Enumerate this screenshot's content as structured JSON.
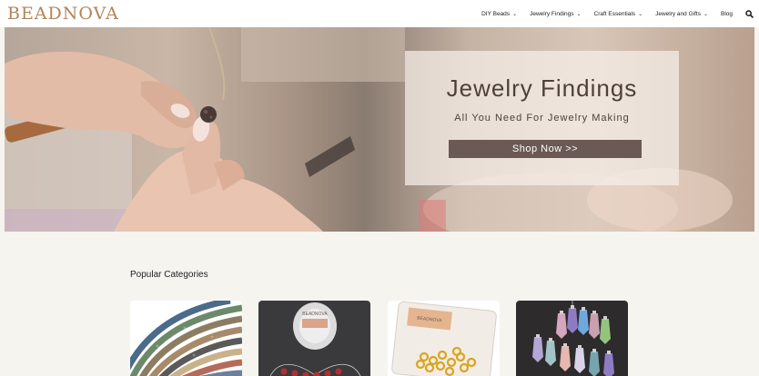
{
  "header": {
    "logo": "BEADNOVA",
    "nav": [
      {
        "label": "DIY Beads",
        "dropdown": true
      },
      {
        "label": "Jewelry Findings",
        "dropdown": true
      },
      {
        "label": "Craft Essentials",
        "dropdown": true
      },
      {
        "label": "Jewelry and Gifts",
        "dropdown": true
      },
      {
        "label": "Blog",
        "dropdown": false
      }
    ],
    "search_icon": "search-icon"
  },
  "hero": {
    "title": "Jewelry Findings",
    "subtitle": "All You Need For Jewelry Making",
    "button_label": "Shop Now >>"
  },
  "categories": {
    "title": "Popular Categories",
    "cards": [
      {
        "image": "lava-bead-strands"
      },
      {
        "image": "beadnova-elastic-cord-spool",
        "logo_text": "BEADNOVA"
      },
      {
        "image": "beadnova-gold-jump-rings-box",
        "logo_text": "BEADNOVA"
      },
      {
        "image": "crystal-point-pendants"
      }
    ]
  },
  "colors": {
    "logo": "#b3845a",
    "button": "#6a5954",
    "promo_text": "#4e4038",
    "background": "#f5f4ef"
  }
}
